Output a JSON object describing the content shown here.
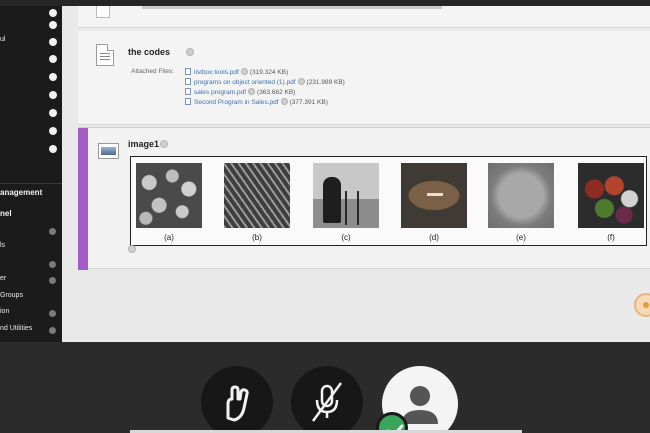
{
  "sidebar": {
    "items_top": [
      {
        "label": ""
      },
      {
        "label": "ul"
      },
      {
        "label": ""
      },
      {
        "label": ""
      },
      {
        "label": ""
      },
      {
        "label": ""
      },
      {
        "label": ""
      },
      {
        "label": ""
      },
      {
        "label": ""
      }
    ],
    "section_title": "anagement",
    "section_sub": "nel",
    "items_bottom": [
      {
        "label": ""
      },
      {
        "label": "ls"
      },
      {
        "label": ""
      },
      {
        "label": "er"
      },
      {
        "label": "Groups"
      },
      {
        "label": "ion"
      },
      {
        "label": "nd Utilities"
      }
    ]
  },
  "content": {
    "item1": {
      "title": "the codes",
      "attached_label": "Attached Files:",
      "files": [
        {
          "name": "listbox tools.pdf",
          "size": "(319.324 KB)"
        },
        {
          "name": "programs on object oriented (1).pdf",
          "size": "(231.989 KB)"
        },
        {
          "name": "sales program.pdf",
          "size": "(363.662 KB)"
        },
        {
          "name": "Second Program in Sales.pdf",
          "size": "(377.391 KB)"
        }
      ]
    },
    "item2": {
      "title": "image1",
      "captions": [
        "(a)",
        "(b)",
        "(c)",
        "(d)",
        "(e)",
        "(f)"
      ]
    }
  },
  "call_controls": {
    "raise_hand_icon": "hand-icon",
    "mic_icon": "mic-muted-icon",
    "camera_icon": "avatar-icon",
    "status_icon": "check-icon"
  },
  "colors": {
    "accent": "#a35dc6",
    "link": "#3b6fb2",
    "status": "#38a55a"
  }
}
